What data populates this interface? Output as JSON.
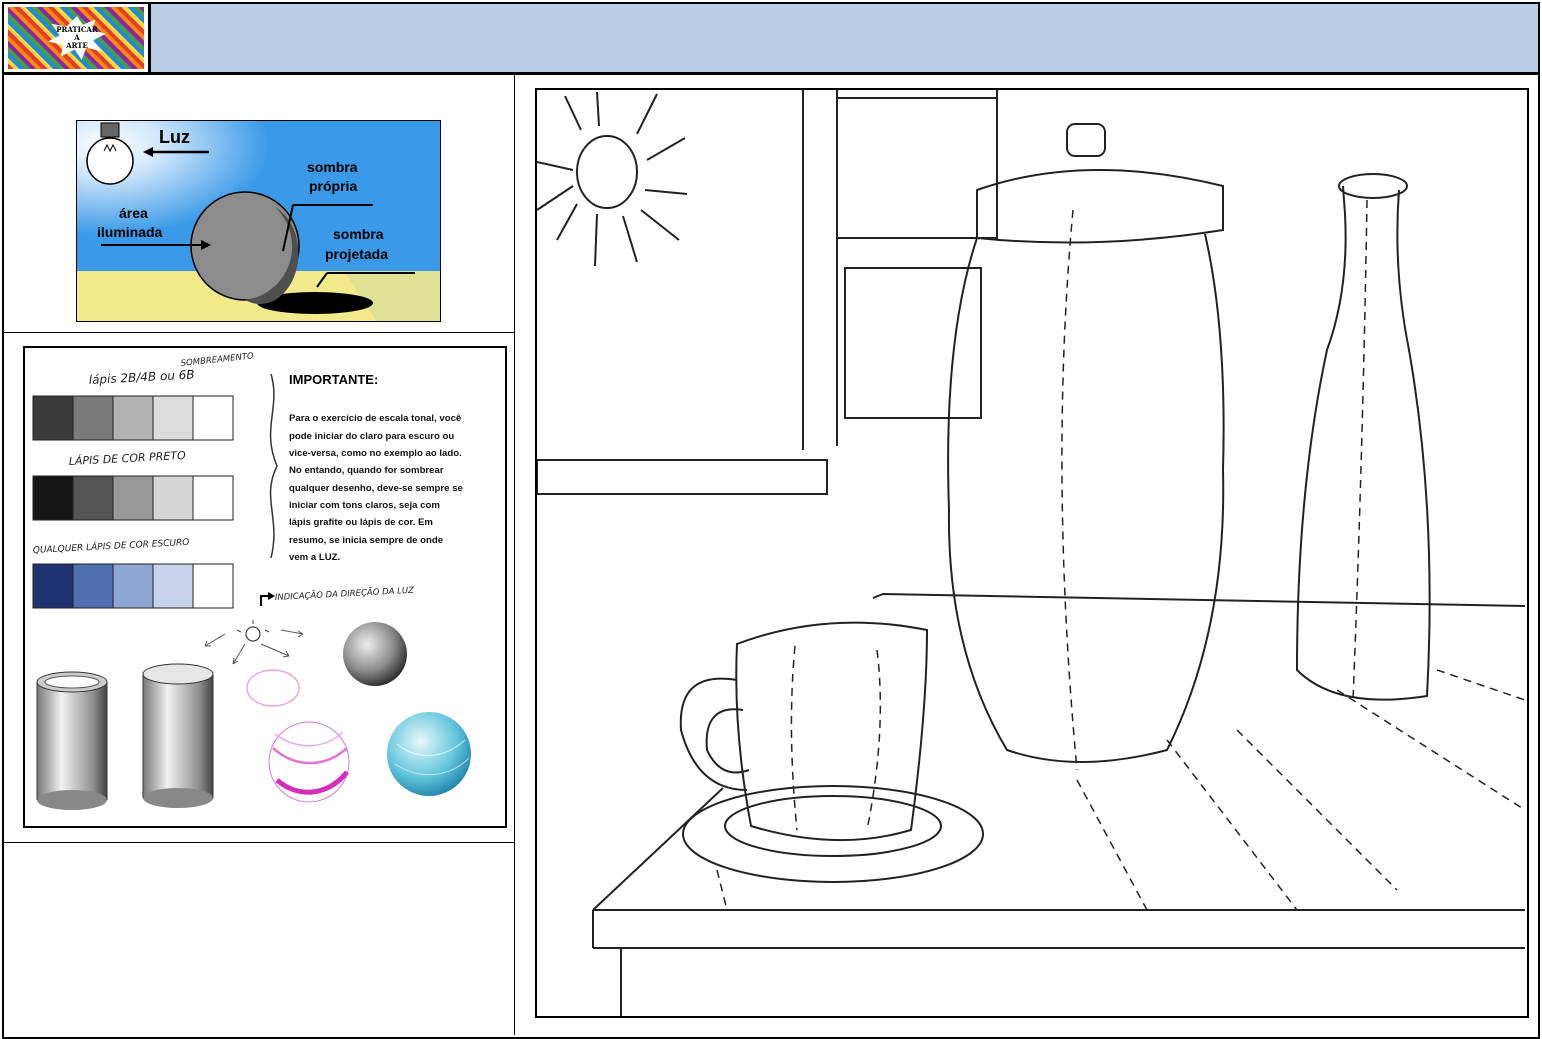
{
  "header": {
    "logo": {
      "text": [
        "PRATICAR",
        "A",
        "ARTE"
      ]
    },
    "title": ""
  },
  "light_diagram": {
    "labels": {
      "light": "Luz",
      "lit_area": [
        "área",
        "iluminada"
      ],
      "own_shadow": [
        "sombra",
        "própria"
      ],
      "cast_shadow": [
        "sombra",
        "projetada"
      ]
    },
    "colors": {
      "sky": "#3a9ae8",
      "ground": "#f1e98a",
      "sphere": "#8c8c8c",
      "shadow": "#000000"
    }
  },
  "shading_sheet": {
    "heading": "SOMBREAMENTO",
    "scale_1_label": "lápis 2B/4B ou 6B",
    "scale_2_label": "LÁPIS DE COR PRETO",
    "scale_3_label": "QUALQUER LÁPIS DE COR ESCURO",
    "scale_1_tones": [
      "#3a3a3a",
      "#7a7a7a",
      "#b3b3b3",
      "#dcdcdc",
      "#ffffff"
    ],
    "scale_2_tones": [
      "#151515",
      "#555555",
      "#999999",
      "#d6d6d6",
      "#ffffff"
    ],
    "scale_3_tones": [
      "#1e3370",
      "#4f6fb0",
      "#8ea6d2",
      "#c6d3ea",
      "#ffffff"
    ],
    "note_title": "IMPORTANTE:",
    "note_lines": [
      "Para o exercício de escala tonal, você",
      "pode iniciar do claro para escuro ou",
      "vice-versa, como no exemplo ao lado.",
      "No entando, quando for sombrear",
      "qualquer desenho, deve-se sempre se",
      "iniciar com tons claros, seja com",
      "lápis grafite ou lápis de cor. Em",
      "resumo, se inicia sempre de onde",
      "vem a LUZ."
    ],
    "light_direction_label": "INDICAÇÃO DA DIREÇÃO DA LUZ"
  },
  "still_life": {
    "objects": [
      "sun",
      "window",
      "jar",
      "bottle",
      "cup",
      "saucer",
      "table"
    ]
  }
}
